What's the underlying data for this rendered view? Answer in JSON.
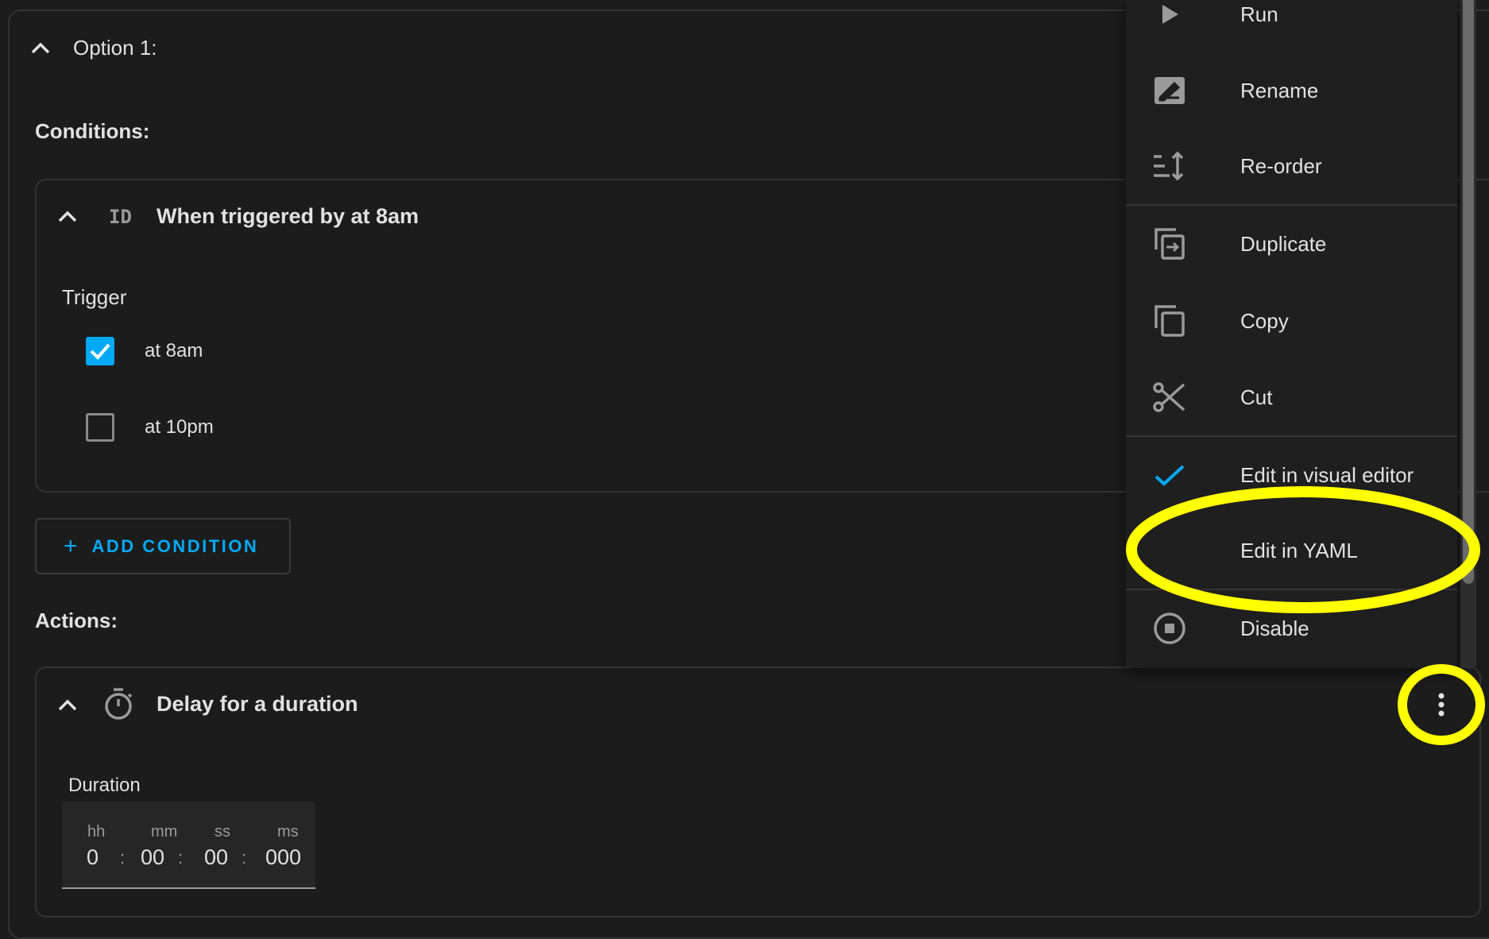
{
  "option": {
    "title": "Option 1:"
  },
  "conditions": {
    "heading": "Conditions:",
    "card": {
      "title": "When triggered by at 8am",
      "icon": "id-icon",
      "field_label": "Trigger",
      "options": [
        {
          "label": "at 8am",
          "checked": true
        },
        {
          "label": "at 10pm",
          "checked": false
        }
      ]
    },
    "add_button": "ADD CONDITION"
  },
  "actions": {
    "heading": "Actions:",
    "card": {
      "title": "Delay for a duration",
      "icon": "timer-icon",
      "field_label": "Duration",
      "duration": {
        "labels": [
          "hh",
          "mm",
          "ss",
          "ms"
        ],
        "values": [
          "0",
          "00",
          "00",
          "000"
        ],
        "separator": ":"
      }
    }
  },
  "menu": {
    "items": [
      {
        "label": "Run",
        "icon": "play-icon"
      },
      {
        "label": "Rename",
        "icon": "rename-icon"
      },
      {
        "label": "Re-order",
        "icon": "reorder-icon"
      },
      {
        "label": "Duplicate",
        "icon": "duplicate-icon"
      },
      {
        "label": "Copy",
        "icon": "copy-icon"
      },
      {
        "label": "Cut",
        "icon": "scissors-icon"
      },
      {
        "label": "Edit in visual editor",
        "icon": "check-icon",
        "selected": true
      },
      {
        "label": "Edit in YAML",
        "icon": "none"
      },
      {
        "label": "Disable",
        "icon": "stop-circle-icon"
      }
    ]
  },
  "colors": {
    "accent": "#03a9f4",
    "highlight": "#ffff00",
    "background": "#1c1c1c"
  }
}
